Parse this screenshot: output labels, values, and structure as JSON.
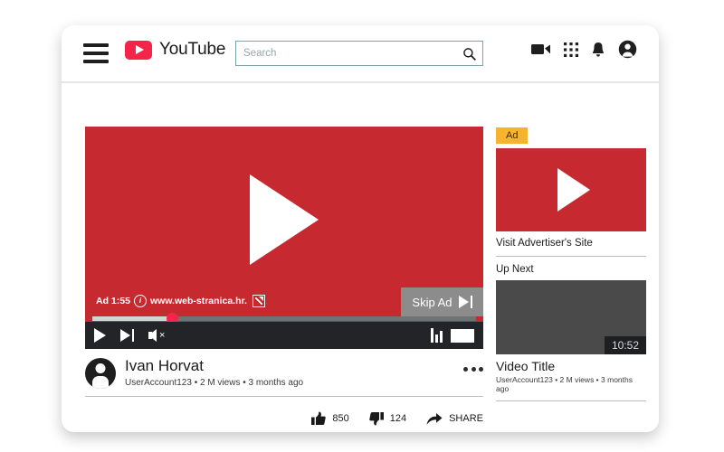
{
  "header": {
    "menu_icon": "hamburger-menu-icon",
    "brand_label": "YouTube",
    "brand_logo_icon": "youtube-play-logo-icon",
    "search": {
      "placeholder": "Search",
      "value": "",
      "button_icon": "search-icon"
    },
    "icons": [
      {
        "name": "video-camera-icon",
        "label": "Create video"
      },
      {
        "name": "apps-grid-icon",
        "label": "Apps"
      },
      {
        "name": "bell-icon",
        "label": "Notifications"
      },
      {
        "name": "account-avatar-icon",
        "label": "Account"
      }
    ]
  },
  "player": {
    "play_icon": "play-triangle-icon",
    "ad_label": "Ad 1:55",
    "ad_info_icon": "info-circle-icon",
    "ad_url": "www.web-stranica.hr.",
    "ad_external_icon": "external-link-icon",
    "skip_label": "Skip Ad",
    "skip_icon": "skip-forward-icon",
    "progress_percent": 21,
    "controls": {
      "play_icon": "play-icon",
      "next_icon": "next-track-icon",
      "mute_icon": "volume-muted-icon",
      "quality_icon": "signal-bars-icon",
      "fullscreen_icon": "screen-rectangle-icon"
    },
    "colors": {
      "video_red": "#c62a30",
      "skip_gray": "#8c8c8c",
      "controls_bar": "#222428",
      "scrubber": "#f5254a"
    }
  },
  "video_info": {
    "avatar_icon": "user-avatar-icon",
    "title": "Ivan Horvat",
    "meta": "UserAccount123 • 2 M views • 3 months ago",
    "more_icon": "more-options-icon",
    "actions": [
      {
        "name": "like-button",
        "icon": "thumbs-up-icon",
        "label": "850"
      },
      {
        "name": "dislike-button",
        "icon": "thumbs-down-icon",
        "label": "124"
      },
      {
        "name": "share-button",
        "icon": "share-arrow-icon",
        "label": "SHARE"
      }
    ]
  },
  "sidebar": {
    "ad_badge": "Ad",
    "ad_play_icon": "play-triangle-icon",
    "ad_link": "Visit Advertiser's Site",
    "up_next_label": "Up Next",
    "next_video": {
      "duration": "10:52",
      "title": "Video Title",
      "meta": "UserAccount123 • 2 M views • 3 months ago"
    },
    "colors": {
      "ad_badge_bg": "#f7b32b",
      "ad_thumb_bg": "#c62a30",
      "next_thumb_bg": "#4a4a4a"
    }
  }
}
